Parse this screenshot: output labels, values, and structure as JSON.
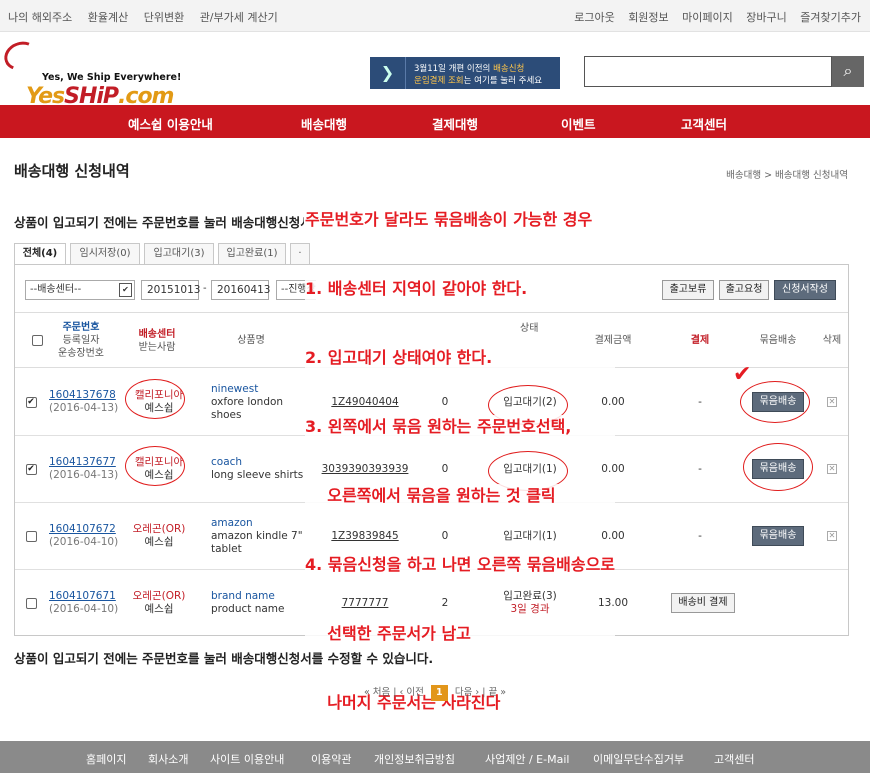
{
  "topbar": {
    "left": [
      "나의 해외주소",
      "환율계산",
      "단위변환",
      "관/부가세 계산기"
    ],
    "right": [
      "로그아웃",
      "회원정보",
      "마이페이지",
      "장바구니",
      "즐겨찾기추가"
    ]
  },
  "logo": {
    "tagline": "Yes, We Ship Everywhere!",
    "name_a": "Yes",
    "name_b": "SHiP",
    "name_c": ".com"
  },
  "banner": {
    "line1a": "3월11일 개편 이전의 ",
    "line1b": "배송신청",
    "line2a": "운임결제 조회",
    "line2b": "는 여기를 눌러 주세요"
  },
  "search": {
    "placeholder": ""
  },
  "nav": [
    "예스쉽 이용안내",
    "배송대행",
    "결제대행",
    "이벤트",
    "고객센터"
  ],
  "page": {
    "title": "배송대행 신청내역",
    "breadcrumb": "배송대행 > 배송대행 신청내역",
    "note": "상품이 입고되기 전에는 주문번호를 눌러 배송대행신청서를 수정할 수 있습니다.",
    "note2": "상품이 입고되기 전에는 주문번호를 눌러 배송대행신청서를 수정할 수 있습니다."
  },
  "tabs": [
    "전체(4)",
    "임시저장(0)",
    "입고대기(3)",
    "입고완료(1)",
    "·"
  ],
  "filter": {
    "center": "--배송센터--",
    "from": "20151013",
    "to": "20160413",
    "status": "--진행상",
    "btn1": "출고보류",
    "btn2": "출고요청",
    "btn3": "신청서작성"
  },
  "headers": {
    "order_a": "주문번호",
    "order_b": "등록일자",
    "order_c": "운송장번호",
    "center_a": "배송센터",
    "center_b": "받는사람",
    "product": "상품명",
    "status": "상태",
    "amount": "결제금액",
    "pay": "결제",
    "bundle": "묶음배송",
    "del": "삭제"
  },
  "rows": [
    {
      "checked": "✔",
      "order": "1604137678",
      "date": "(2016-04-13)",
      "center": "캘리포니아",
      "receiver": "예스쉽",
      "brand": "ninewest",
      "pname": "oxfore london shoes",
      "track": "1Z49040404",
      "qty": "0",
      "status": "입고대기(2)",
      "status2": "",
      "amount": "0.00",
      "pay": "-",
      "action": "묶음배송",
      "del": "✕"
    },
    {
      "checked": "✔",
      "order": "1604137677",
      "date": "(2016-04-13)",
      "center": "캘리포니아",
      "receiver": "예스쉽",
      "brand": "coach",
      "pname": "long sleeve shirts",
      "track": "3039390393939",
      "qty": "0",
      "status": "입고대기(1)",
      "status2": "",
      "amount": "0.00",
      "pay": "-",
      "action": "묶음배송",
      "del": "✕"
    },
    {
      "checked": "",
      "order": "1604107672",
      "date": "(2016-04-10)",
      "center": "오레곤(OR)",
      "receiver": "예스쉽",
      "brand": "amazon",
      "pname": "amazon kindle 7\" tablet",
      "track": "1Z39839845",
      "qty": "0",
      "status": "입고대기(1)",
      "status2": "",
      "amount": "0.00",
      "pay": "-",
      "action": "묶음배송",
      "del": "✕"
    },
    {
      "checked": "",
      "order": "1604107671",
      "date": "(2016-04-10)",
      "center": "오레곤(OR)",
      "receiver": "예스쉽",
      "brand": "brand name",
      "pname": "product name",
      "track": "7777777",
      "qty": "2",
      "status": "입고완료(3)",
      "status2": "3일 경과",
      "amount": "13.00",
      "pay": "배송비 결제",
      "action": "",
      "del": ""
    }
  ],
  "pager": {
    "first": "« 처음",
    "prev": "‹ 이전",
    "page": "1",
    "next": "다음 ›",
    "last": "끝 »"
  },
  "footer": [
    "홈페이지",
    "회사소개",
    "사이트 이용안내",
    "이용약관",
    "개인정보취급방침",
    "사업제안 / E-Mail",
    "이메일무단수집거부",
    "고객센터"
  ],
  "annotation": [
    "주문번호가 달라도 묶음배송이 가능한 경우",
    "1. 배송센터 지역이 같아야 한다.",
    "2. 입고대기 상태여야 한다.",
    "3. 왼쪽에서 묶음 원하는 주문번호선택,",
    "    오른쪽에서 묶음을 원하는 것 클릭",
    "4. 묶음신청을 하고 나면 오른쪽 묶음배송으로",
    "    선택한 주문서가 남고",
    "    나머지 주문서는 사라진다"
  ]
}
